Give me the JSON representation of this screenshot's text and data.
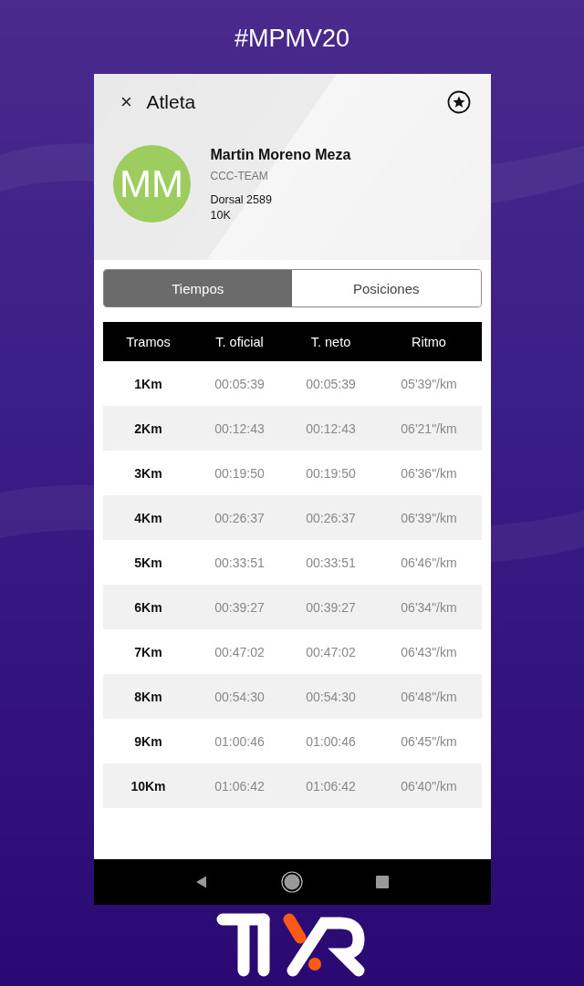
{
  "hashtag": "#MPMV20",
  "header": {
    "close": "×",
    "title": "Atleta"
  },
  "athlete": {
    "initials": "MM",
    "name": "Martin Moreno Meza",
    "team": "CCC-TEAM",
    "bib": "Dorsal 2589",
    "distance": "10K"
  },
  "tabs": [
    {
      "label": "Tiempos",
      "selected": true
    },
    {
      "label": "Posiciones",
      "selected": false
    }
  ],
  "table": {
    "columns": [
      "Tramos",
      "T. oficial",
      "T. neto",
      "Ritmo"
    ],
    "rows": [
      [
        "1Km",
        "00:05:39",
        "00:05:39",
        "05'39\"/km"
      ],
      [
        "2Km",
        "00:12:43",
        "00:12:43",
        "06'21\"/km"
      ],
      [
        "3Km",
        "00:19:50",
        "00:19:50",
        "06'36\"/km"
      ],
      [
        "4Km",
        "00:26:37",
        "00:26:37",
        "06'39\"/km"
      ],
      [
        "5Km",
        "00:33:51",
        "00:33:51",
        "06'46\"/km"
      ],
      [
        "6Km",
        "00:39:27",
        "00:39:27",
        "06'34\"/km"
      ],
      [
        "7Km",
        "00:47:02",
        "00:47:02",
        "06'43\"/km"
      ],
      [
        "8Km",
        "00:54:30",
        "00:54:30",
        "06'48\"/km"
      ],
      [
        "9Km",
        "01:00:46",
        "01:00:46",
        "06'45\"/km"
      ],
      [
        "10Km",
        "01:06:42",
        "01:06:42",
        "06'40\"/km"
      ]
    ]
  }
}
